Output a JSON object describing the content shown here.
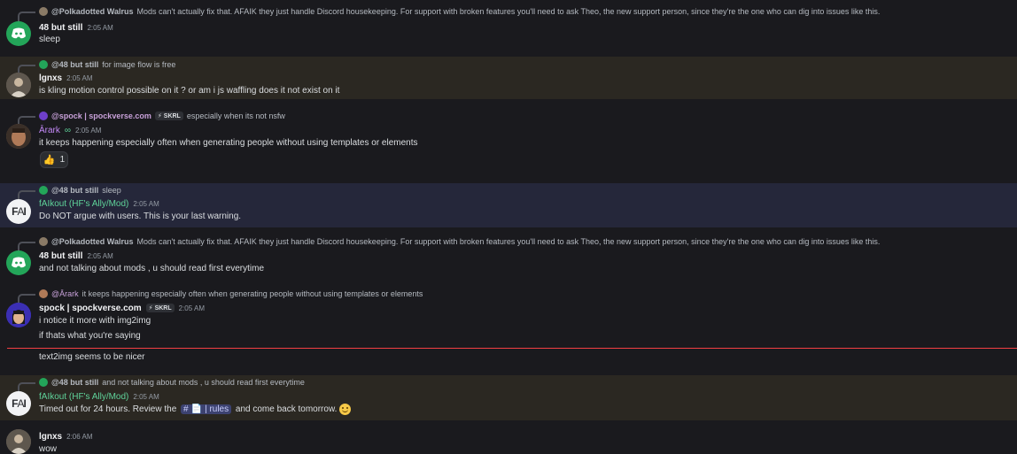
{
  "messages": [
    {
      "reply": {
        "name": "@Polkadotted Walrus",
        "text": "Mods can't actually fix that. AFAIK they just handle Discord housekeeping. For support with broken features you'll need to ask Theo, the new support person, since they're the one who can dig into issues like this."
      },
      "author": "48 but still",
      "time": "2:05 AM",
      "lines": [
        "sleep"
      ],
      "avatar": "discord-icon"
    },
    {
      "reply": {
        "name": "@48 but still",
        "text": "for image flow is free"
      },
      "author": "lgnxs",
      "time": "2:05 AM",
      "lines": [
        "is kling motion control possible on it ? or am i js waffling does it not exist on it"
      ],
      "avatar": "photo"
    },
    {
      "reply": {
        "name": "@spock | spockverse.com",
        "tag": "SKRL",
        "text": "especially when its not nsfw"
      },
      "author": "Ārark",
      "author_suffix": "∞",
      "time": "2:05 AM",
      "lines": [
        "it keeps happening especially often when generating people without using templates or elements"
      ],
      "avatar": "face",
      "reaction": {
        "emoji": "thumbs-up-icon",
        "count": "1"
      }
    },
    {
      "reply": {
        "name": "@48 but still",
        "text": "sleep"
      },
      "author": "fAIkout (HF's Ally/Mod)",
      "time": "2:05 AM",
      "lines": [
        "Do NOT argue with users. This is your last warning."
      ],
      "avatar": "FAI"
    },
    {
      "reply": {
        "name": "@Polkadotted Walrus",
        "text": "Mods can't actually fix that. AFAIK they just handle Discord housekeeping. For support with broken features you'll need to ask Theo, the new support person, since they're the one who can dig into issues like this."
      },
      "author": "48 but still",
      "time": "2:05 AM",
      "lines": [
        "and not talking about mods , u should read first everytime"
      ],
      "avatar": "discord-icon"
    },
    {
      "reply": {
        "name": "@Ārark",
        "text": "it keeps happening especially often when generating people without using templates or elements"
      },
      "author": "spock | spockverse.com",
      "tag": "SKRL",
      "time": "2:05 AM",
      "lines": [
        "i notice it more with img2img",
        "if thats what you're saying"
      ],
      "avatar": "spock"
    },
    {
      "lines": [
        "text2img seems to be nicer"
      ]
    },
    {
      "reply": {
        "name": "@48 but still",
        "text": "and not talking about mods , u should read first everytime"
      },
      "author": "fAIkout (HF's Ally/Mod)",
      "time": "2:05 AM",
      "line_parts": {
        "before": "Timed out for 24 hours. Review the ",
        "channel_hash": "#",
        "channel_name": "| rules",
        "after": " and come back tomorrow."
      },
      "avatar": "FAI"
    },
    {
      "author": "lgnxs",
      "time": "2:06 AM",
      "lines": [
        "wow"
      ],
      "avatar": "photo"
    }
  ],
  "colors": {
    "background": "#1a1a1e",
    "highlight_gold": "#2b2822",
    "highlight_blue": "#25273a",
    "mod_name": "#5fd39a",
    "new_divider": "#f23f43"
  }
}
